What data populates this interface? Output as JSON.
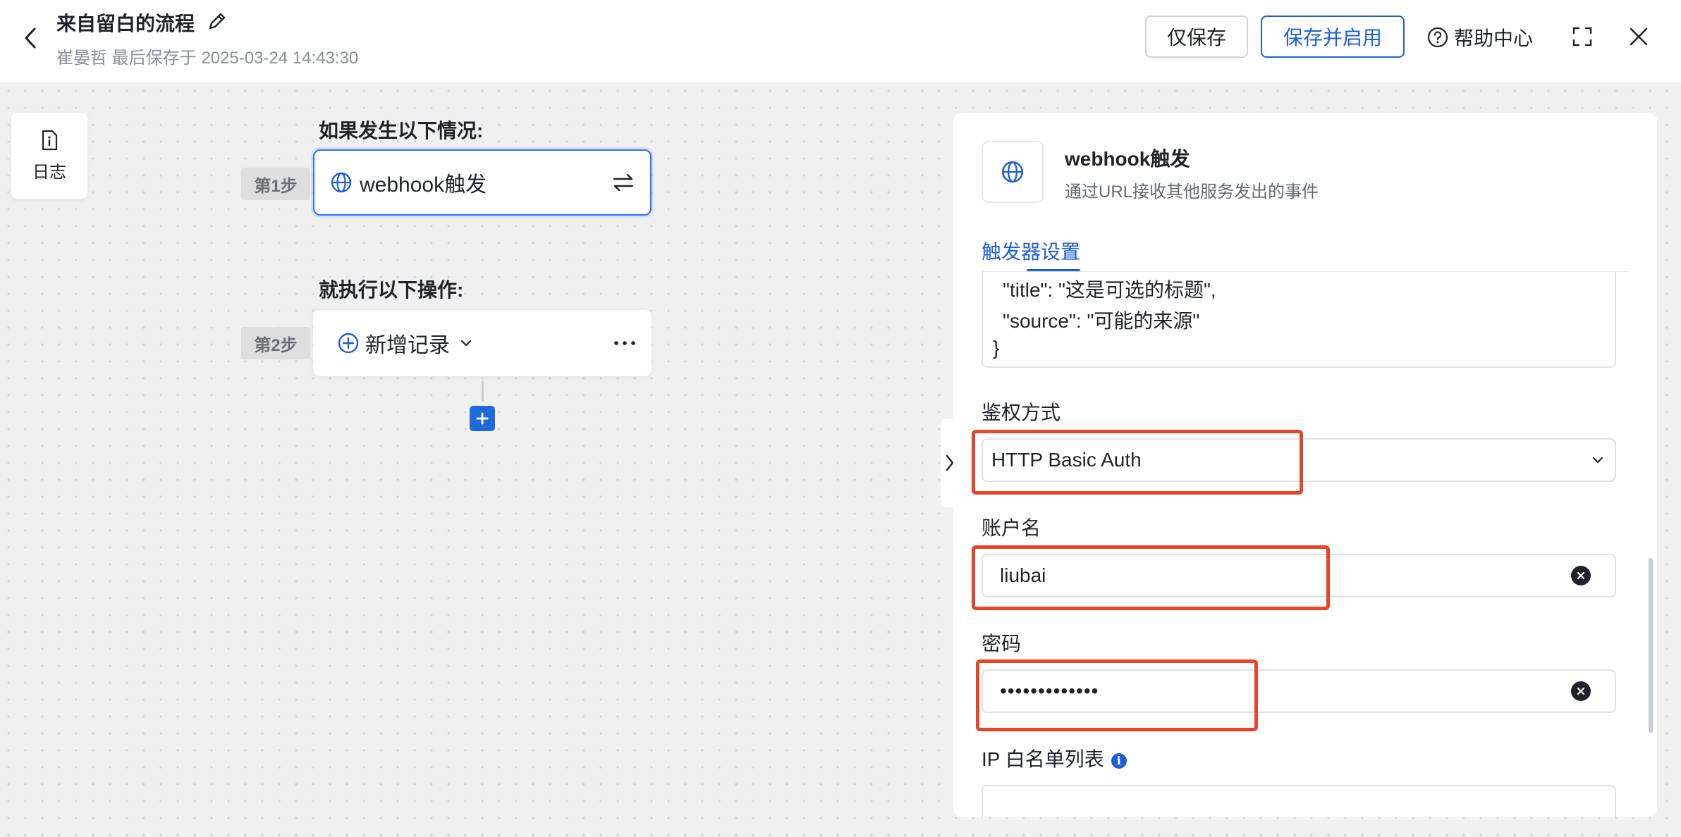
{
  "header": {
    "title": "来自留白的流程",
    "subtitle": "崔晏哲 最后保存于 2025-03-24 14:43:30",
    "save_only_label": "仅保存",
    "save_enable_label": "保存并启用",
    "help_label": "帮助中心",
    "icons": {
      "back": "chevron-left-icon",
      "edit": "pencil-icon",
      "help": "question-circle-icon",
      "fullscreen": "expand-icon",
      "close": "close-icon"
    }
  },
  "canvas": {
    "log_label": "日志",
    "trigger_section_label": "如果发生以下情况:",
    "action_section_label": "就执行以下操作:",
    "step1_label": "第1步",
    "step2_label": "第2步",
    "trigger_node_label": "webhook触发",
    "action_node_label": "新增记录"
  },
  "panel": {
    "title": "webhook触发",
    "description": "通过URL接收其他服务发出的事件",
    "tab_label": "触发器设置",
    "code_lines": [
      "\"title\": \"这是可选的标题\",",
      "\"source\": \"可能的来源\"",
      "}"
    ],
    "auth_label": "鉴权方式",
    "auth_value": "HTTP Basic Auth",
    "username_label": "账户名",
    "username_value": "liubai",
    "password_label": "密码",
    "password_value": "•••••••••••••",
    "ip_whitelist_label": "IP 白名单列表"
  },
  "colors": {
    "accent": "#1f5fd4",
    "highlight": "#e8442a"
  }
}
